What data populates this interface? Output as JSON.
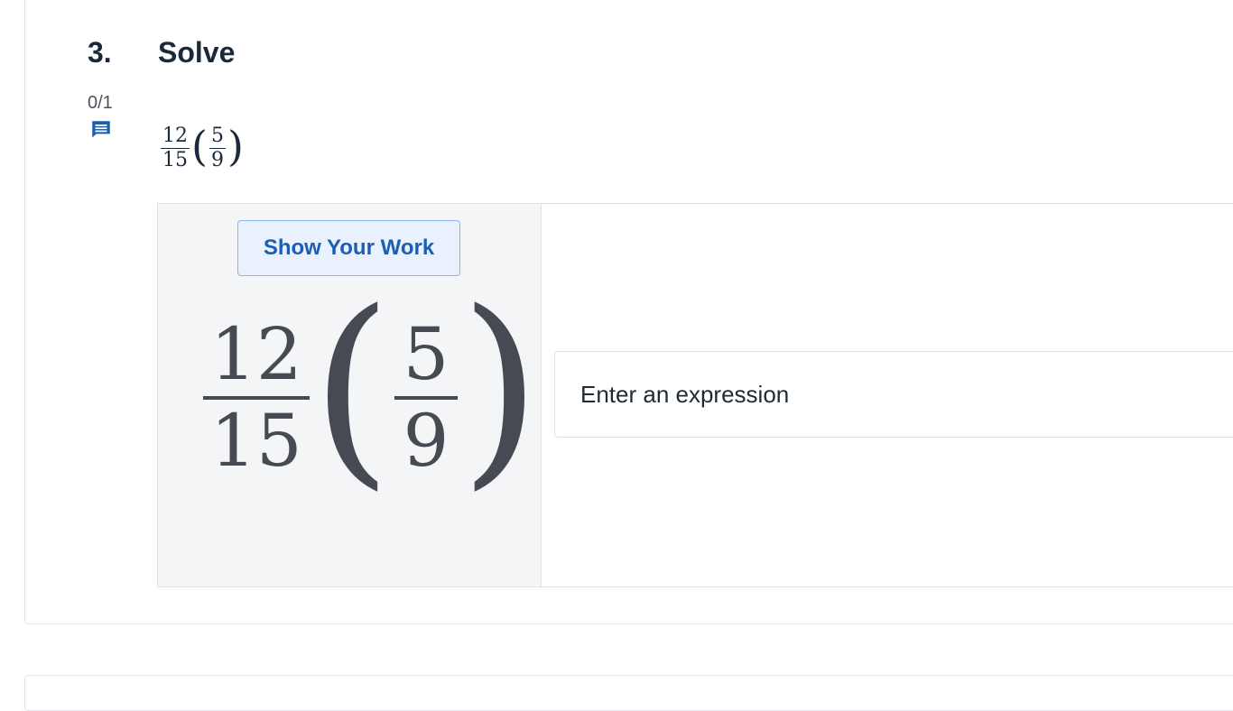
{
  "question": {
    "number": "3.",
    "title": "Solve",
    "score": "0/1",
    "comment_icon": "comment-icon"
  },
  "prompt": {
    "fraction1": {
      "numerator": "12",
      "denominator": "15"
    },
    "fraction2": {
      "numerator": "5",
      "denominator": "9"
    },
    "open_paren": "(",
    "close_paren": ")"
  },
  "work": {
    "show_work_label": "Show Your Work"
  },
  "answer": {
    "placeholder": "Enter an expression",
    "value": ""
  },
  "colors": {
    "accent": "#1a5fb4",
    "panel_bg": "#f4f5f7",
    "button_bg": "#e8f1fd"
  }
}
